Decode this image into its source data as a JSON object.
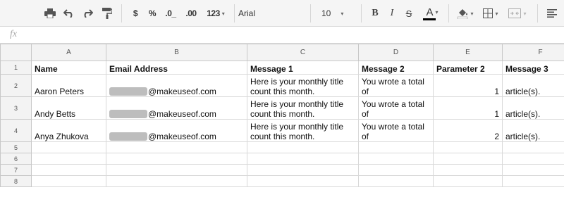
{
  "toolbar": {
    "currency_symbol": "$",
    "percent_symbol": "%",
    "decrease_decimals": ".0_",
    "increase_decimals": ".00",
    "more_formats": "123",
    "font_family": "Arial",
    "font_size": "10",
    "bold": "B",
    "italic": "I",
    "strikethrough": "S",
    "text_color": "A",
    "text_color_value": "#000000"
  },
  "formula_bar": {
    "label": "fx",
    "value": ""
  },
  "columns": [
    "A",
    "B",
    "C",
    "D",
    "E",
    "F"
  ],
  "rows": [
    {
      "number": "1",
      "cells": [
        "Name",
        "Email Address",
        "Message 1",
        "Message 2",
        "Parameter 2",
        "Message 3"
      ]
    },
    {
      "number": "2",
      "cells": [
        "Aaron Peters",
        "@makeuseof.com",
        "Here is your monthly title count this month.",
        "You wrote a total of",
        "1",
        "article(s)."
      ]
    },
    {
      "number": "3",
      "cells": [
        "Andy Betts",
        "@makeuseof.com",
        "Here is your monthly title count this month.",
        "You wrote a total of",
        "1",
        "article(s)."
      ]
    },
    {
      "number": "4",
      "cells": [
        "Anya Zhukova",
        "@makeuseof.com",
        "Here is your monthly title count this month.",
        "You wrote a total of",
        "2",
        "article(s)."
      ]
    },
    {
      "number": "5",
      "cells": [
        "",
        "",
        "",
        "",
        "",
        ""
      ]
    },
    {
      "number": "6",
      "cells": [
        "",
        "",
        "",
        "",
        "",
        ""
      ]
    },
    {
      "number": "7",
      "cells": [
        "",
        "",
        "",
        "",
        "",
        ""
      ]
    },
    {
      "number": "8",
      "cells": [
        "",
        "",
        "",
        "",
        "",
        ""
      ]
    }
  ]
}
